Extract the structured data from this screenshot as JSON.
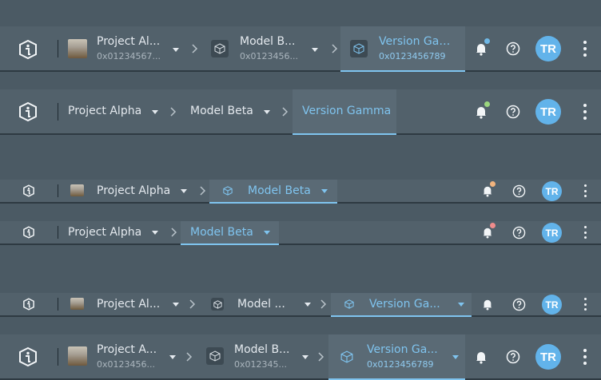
{
  "project": {
    "name": "Project Alpha",
    "name_trunc_1": "Project Al...",
    "name_trunc_2": "Project A...",
    "id_1": "0x01234567...",
    "id_2": "0x0123456..."
  },
  "model": {
    "name": "Model Beta",
    "name_trunc_1": "Model B...",
    "name_trunc_2": "Model ...",
    "id_1": "0x0123456...",
    "id_2": "0x012345..."
  },
  "version": {
    "name": "Version Gamma",
    "name_trunc_1": "Version Gam...",
    "name_trunc_2": "Version Ga...",
    "id": "0x0123456789"
  },
  "user": {
    "initials": "TR"
  },
  "colors": {
    "accent": "#7fc4ef",
    "avatar": "#62b3ea",
    "dot_blue": "#6fb8e6",
    "dot_green": "#9bd67e",
    "dot_orange": "#f2b47e",
    "dot_red": "#f08c8c"
  },
  "icons": {
    "logo": "info-logo-icon",
    "chevron": "chevron-right-icon",
    "caret": "caret-down-icon",
    "bell": "bell-icon",
    "help": "question-icon",
    "menu": "kebab-menu-icon",
    "model": "cube-icon",
    "project": "project-thumbnail"
  }
}
